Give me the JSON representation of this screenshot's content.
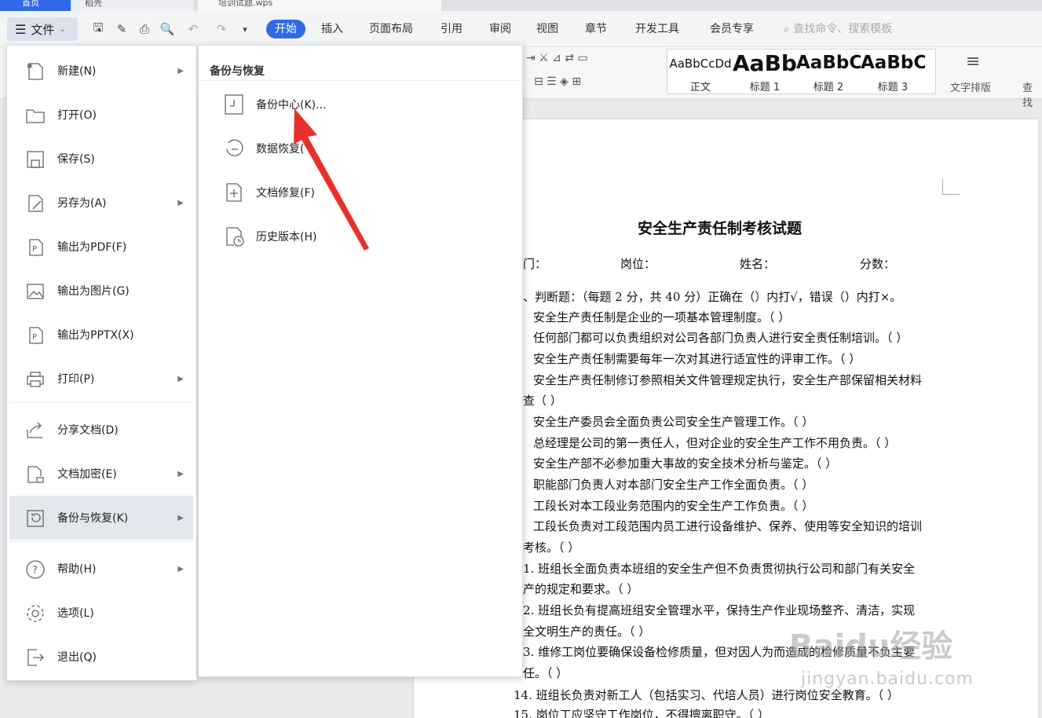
{
  "tabs": {
    "home": "首页",
    "recent": "稻壳",
    "doc": "培训试题.wps"
  },
  "toolbar": {
    "file_label": "文件",
    "ribbon_tabs": [
      "开始",
      "插入",
      "页面布局",
      "引用",
      "审阅",
      "视图",
      "章节",
      "开发工具",
      "会员专享"
    ],
    "search_placeholder": "查找命令、搜索模板",
    "text_layout": "文字排版",
    "find_partial": "查找"
  },
  "styles": [
    {
      "sample": "AaBbCcDd",
      "name": "正文"
    },
    {
      "sample": "AaBb",
      "name": "标题 1"
    },
    {
      "sample": "AaBbC",
      "name": "标题 2"
    },
    {
      "sample": "AaBbC",
      "name": "标题 3"
    }
  ],
  "file_menu": {
    "items": [
      {
        "label": "新建(N)",
        "icon": "new-doc-icon",
        "submenu": true
      },
      {
        "label": "打开(O)",
        "icon": "folder-icon",
        "submenu": false
      },
      {
        "label": "保存(S)",
        "icon": "save-icon",
        "submenu": false
      },
      {
        "label": "另存为(A)",
        "icon": "save-as-icon",
        "submenu": true
      },
      {
        "label": "输出为PDF(F)",
        "icon": "pdf-icon",
        "submenu": false
      },
      {
        "label": "输出为图片(G)",
        "icon": "image-icon",
        "submenu": false
      },
      {
        "label": "输出为PPTX(X)",
        "icon": "pptx-icon",
        "submenu": false
      },
      {
        "label": "打印(P)",
        "icon": "print-icon",
        "submenu": true
      },
      {
        "label": "分享文档(D)",
        "icon": "share-icon",
        "submenu": false
      },
      {
        "label": "文档加密(E)",
        "icon": "lock-doc-icon",
        "submenu": true
      },
      {
        "label": "备份与恢复(K)",
        "icon": "backup-icon",
        "submenu": true
      },
      {
        "label": "帮助(H)",
        "icon": "help-icon",
        "submenu": true
      },
      {
        "label": "选项(L)",
        "icon": "gear-icon",
        "submenu": false
      },
      {
        "label": "退出(Q)",
        "icon": "exit-icon",
        "submenu": false
      }
    ]
  },
  "submenu": {
    "title": "备份与恢复",
    "items": [
      {
        "label": "备份中心(K)...",
        "icon": "backup-center-icon"
      },
      {
        "label": "数据恢复(",
        "icon": "data-recovery-icon"
      },
      {
        "label": "文档修复(F)",
        "icon": "doc-repair-icon"
      },
      {
        "label": "历史版本(H)",
        "icon": "history-version-icon"
      }
    ]
  },
  "document": {
    "title": "安全生产责任制考核试题",
    "fields": [
      "门：",
      "岗位：",
      "姓名：",
      "分数："
    ],
    "lines": [
      "、判断题：（每题 2 分，共 40 分）正确在（）内打√，错误（）内打×。",
      "安全生产责任制是企业的一项基本管理制度。（    ）",
      "任何部门都可以负责组织对公司各部门负责人进行安全责任制培训。（    ）",
      "安全生产责任制需要每年一次对其进行适宜性的评审工作。（    ）",
      "安全生产责任制修订参照相关文件管理规定执行，安全生产部保留相关材料",
      "查（    ）",
      "安全生产委员会全面负责公司安全生产管理工作。（    ）",
      "总经理是公司的第一责任人，但对企业的安全生产工作不用负责。（    ）",
      "安全生产部不必参加重大事故的安全技术分析与鉴定。（    ）",
      "职能部门负责人对本部门安全生产工作全面负责。（    ）",
      "工段长对本工段业务范围内的安全生产工作负责。（    ）",
      "工段长负责对工段范围内员工进行设备维护、保养、使用等安全知识的培训",
      "考核。（    ）",
      "1. 班组长全面负责本班组的安全生产但不负责贯彻执行公司和部门有关安全",
      "产的规定和要求。（    ）",
      "2. 班组长负有提高班组安全管理水平，保持生产作业现场整齐、清洁，实现",
      "全文明生产的责任。（    ）",
      "3. 维修工岗位要确保设备检修质量，但对因人为而造成的检修质量不负主要",
      "任。（    ）",
      "14. 班组长负责对新工人（包括实习、代培人员）进行岗位安全教育。（    ）",
      "15. 岗位工应坚守工作岗位，不得擅离职守。（    ）"
    ]
  },
  "watermark": {
    "main": "Baidu经验",
    "sub": "jingyan.baidu.com"
  },
  "colors": {
    "accent": "#2f6be8",
    "arrow": "#e8302a"
  }
}
